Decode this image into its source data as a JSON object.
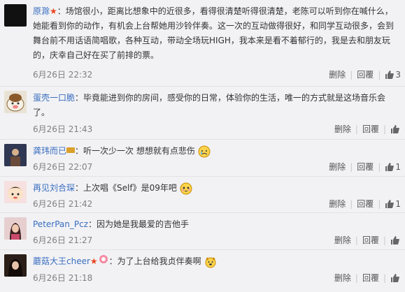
{
  "comments": [
    {
      "name": "原滁",
      "text_before": "：场馆很小，距离比想象中的近很多，看得很清楚听得很清楚，老陈可以听到你在喊什么，她能看到你的动作，有机会上台帮她用沙铃伴奏。这一次的互动做得很好，和同学互动很多，会到舞台前不用话语简唱歌，各种互动，带动全场玩HIGH，我本来是看不着郁行的，我是去和朋友玩的，庆幸自己好在买了前排的票。",
      "time": "6月26日 22:32",
      "delete": "删除",
      "reply": "回覆",
      "likes": "3"
    },
    {
      "name": "蛋壳一口脆",
      "text_before": "：毕竟能进到你的房间，感受你的日常，体验你的生活，唯一的方式就是这场音乐会了。",
      "time": "6月26日 21:43",
      "delete": "删除",
      "reply": "回覆",
      "likes": ""
    },
    {
      "name": "龚玮而已",
      "text_before": "：听一次少一次 想想就有点悲伤",
      "time": "6月26日 22:07",
      "delete": "删除",
      "reply": "回覆",
      "likes": "1"
    },
    {
      "name": "再见刘合琛",
      "text_before": "：上次唱《Self》是09年吧",
      "time": "6月26日 21:42",
      "delete": "删除",
      "reply": "回覆",
      "likes": "1"
    },
    {
      "name": "PeterPan_Pcz",
      "text_before": "：因为她是我最爱的吉他手",
      "time": "6月26日 21:27",
      "delete": "删除",
      "reply": "回覆",
      "likes": ""
    },
    {
      "name": "蘑菇大王cheer",
      "text_before": "：为了上台给我贞伴奏啊",
      "time": "6月26日 21:18",
      "delete": "删除",
      "reply": "回覆",
      "likes": ""
    }
  ],
  "colors": {
    "link": "#3a6ebf",
    "star": "#e8461e",
    "meta": "#808080"
  },
  "icons": [
    "thumbs-up-icon",
    "star-icon",
    "emoji-sad-icon",
    "emoji-blush-icon",
    "emoji-dog-icon",
    "badge-icon"
  ]
}
